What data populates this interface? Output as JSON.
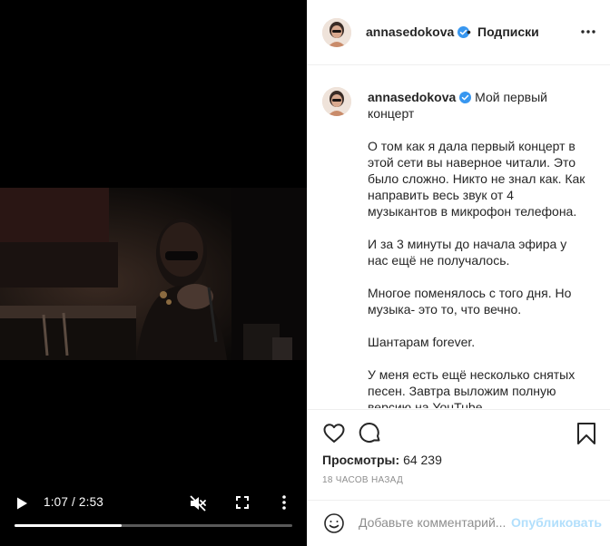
{
  "video": {
    "time_display": "1:07 / 2:53",
    "progress": 0.387,
    "icons": {
      "play": "play-icon",
      "mute": "muted-speaker-icon",
      "fullscreen": "fullscreen-icon",
      "more": "vertical-dots-icon"
    }
  },
  "header": {
    "username": "annasedokova",
    "separator": "•",
    "follow_label": "Подписки",
    "icons": {
      "verified": "verified-badge-icon",
      "more": "horizontal-dots-icon"
    }
  },
  "caption": {
    "username": "annasedokova",
    "title": "Мой первый концерт",
    "paragraphs": [
      "О том как я дала первый концерт в этой сети вы наверное читали. Это было сложно. Никто не знал как. Как направить весь звук от 4 музыкантов в микрофон телефона.",
      "И за 3 минуты до начала эфира у нас ещё не получалось.",
      "Многое поменялось с того дня. Но музыка- это то, что вечно.",
      "Шантарам forever.",
      "У меня есть ещё несколько снятых песен. Завтра выложим полную версию на YouTube"
    ]
  },
  "actions": {
    "views_label": "Просмотры:",
    "views_count": "64 239",
    "timestamp": "18 ЧАСОВ НАЗАД",
    "icons": {
      "like": "heart-icon",
      "comment": "comment-bubble-icon",
      "save": "bookmark-icon"
    }
  },
  "comment": {
    "placeholder": "Добавьте комментарий...",
    "publish_label": "Опубликовать",
    "icons": {
      "emoji": "smiley-icon"
    }
  },
  "colors": {
    "verified": "#3897f0",
    "publish": "#b2dffc",
    "muted_text": "#8e8e8e",
    "border": "#efefef"
  }
}
